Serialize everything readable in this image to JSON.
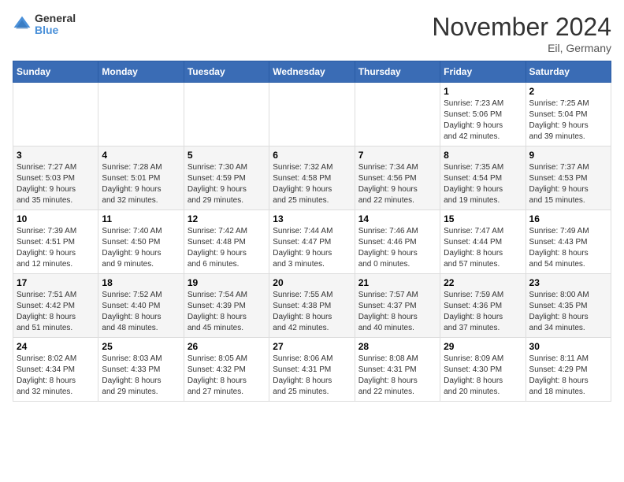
{
  "header": {
    "logo_general": "General",
    "logo_blue": "Blue",
    "month_title": "November 2024",
    "location": "Eil, Germany"
  },
  "weekdays": [
    "Sunday",
    "Monday",
    "Tuesday",
    "Wednesday",
    "Thursday",
    "Friday",
    "Saturday"
  ],
  "weeks": [
    [
      {
        "day": "",
        "info": ""
      },
      {
        "day": "",
        "info": ""
      },
      {
        "day": "",
        "info": ""
      },
      {
        "day": "",
        "info": ""
      },
      {
        "day": "",
        "info": ""
      },
      {
        "day": "1",
        "info": "Sunrise: 7:23 AM\nSunset: 5:06 PM\nDaylight: 9 hours\nand 42 minutes."
      },
      {
        "day": "2",
        "info": "Sunrise: 7:25 AM\nSunset: 5:04 PM\nDaylight: 9 hours\nand 39 minutes."
      }
    ],
    [
      {
        "day": "3",
        "info": "Sunrise: 7:27 AM\nSunset: 5:03 PM\nDaylight: 9 hours\nand 35 minutes."
      },
      {
        "day": "4",
        "info": "Sunrise: 7:28 AM\nSunset: 5:01 PM\nDaylight: 9 hours\nand 32 minutes."
      },
      {
        "day": "5",
        "info": "Sunrise: 7:30 AM\nSunset: 4:59 PM\nDaylight: 9 hours\nand 29 minutes."
      },
      {
        "day": "6",
        "info": "Sunrise: 7:32 AM\nSunset: 4:58 PM\nDaylight: 9 hours\nand 25 minutes."
      },
      {
        "day": "7",
        "info": "Sunrise: 7:34 AM\nSunset: 4:56 PM\nDaylight: 9 hours\nand 22 minutes."
      },
      {
        "day": "8",
        "info": "Sunrise: 7:35 AM\nSunset: 4:54 PM\nDaylight: 9 hours\nand 19 minutes."
      },
      {
        "day": "9",
        "info": "Sunrise: 7:37 AM\nSunset: 4:53 PM\nDaylight: 9 hours\nand 15 minutes."
      }
    ],
    [
      {
        "day": "10",
        "info": "Sunrise: 7:39 AM\nSunset: 4:51 PM\nDaylight: 9 hours\nand 12 minutes."
      },
      {
        "day": "11",
        "info": "Sunrise: 7:40 AM\nSunset: 4:50 PM\nDaylight: 9 hours\nand 9 minutes."
      },
      {
        "day": "12",
        "info": "Sunrise: 7:42 AM\nSunset: 4:48 PM\nDaylight: 9 hours\nand 6 minutes."
      },
      {
        "day": "13",
        "info": "Sunrise: 7:44 AM\nSunset: 4:47 PM\nDaylight: 9 hours\nand 3 minutes."
      },
      {
        "day": "14",
        "info": "Sunrise: 7:46 AM\nSunset: 4:46 PM\nDaylight: 9 hours\nand 0 minutes."
      },
      {
        "day": "15",
        "info": "Sunrise: 7:47 AM\nSunset: 4:44 PM\nDaylight: 8 hours\nand 57 minutes."
      },
      {
        "day": "16",
        "info": "Sunrise: 7:49 AM\nSunset: 4:43 PM\nDaylight: 8 hours\nand 54 minutes."
      }
    ],
    [
      {
        "day": "17",
        "info": "Sunrise: 7:51 AM\nSunset: 4:42 PM\nDaylight: 8 hours\nand 51 minutes."
      },
      {
        "day": "18",
        "info": "Sunrise: 7:52 AM\nSunset: 4:40 PM\nDaylight: 8 hours\nand 48 minutes."
      },
      {
        "day": "19",
        "info": "Sunrise: 7:54 AM\nSunset: 4:39 PM\nDaylight: 8 hours\nand 45 minutes."
      },
      {
        "day": "20",
        "info": "Sunrise: 7:55 AM\nSunset: 4:38 PM\nDaylight: 8 hours\nand 42 minutes."
      },
      {
        "day": "21",
        "info": "Sunrise: 7:57 AM\nSunset: 4:37 PM\nDaylight: 8 hours\nand 40 minutes."
      },
      {
        "day": "22",
        "info": "Sunrise: 7:59 AM\nSunset: 4:36 PM\nDaylight: 8 hours\nand 37 minutes."
      },
      {
        "day": "23",
        "info": "Sunrise: 8:00 AM\nSunset: 4:35 PM\nDaylight: 8 hours\nand 34 minutes."
      }
    ],
    [
      {
        "day": "24",
        "info": "Sunrise: 8:02 AM\nSunset: 4:34 PM\nDaylight: 8 hours\nand 32 minutes."
      },
      {
        "day": "25",
        "info": "Sunrise: 8:03 AM\nSunset: 4:33 PM\nDaylight: 8 hours\nand 29 minutes."
      },
      {
        "day": "26",
        "info": "Sunrise: 8:05 AM\nSunset: 4:32 PM\nDaylight: 8 hours\nand 27 minutes."
      },
      {
        "day": "27",
        "info": "Sunrise: 8:06 AM\nSunset: 4:31 PM\nDaylight: 8 hours\nand 25 minutes."
      },
      {
        "day": "28",
        "info": "Sunrise: 8:08 AM\nSunset: 4:31 PM\nDaylight: 8 hours\nand 22 minutes."
      },
      {
        "day": "29",
        "info": "Sunrise: 8:09 AM\nSunset: 4:30 PM\nDaylight: 8 hours\nand 20 minutes."
      },
      {
        "day": "30",
        "info": "Sunrise: 8:11 AM\nSunset: 4:29 PM\nDaylight: 8 hours\nand 18 minutes."
      }
    ]
  ]
}
